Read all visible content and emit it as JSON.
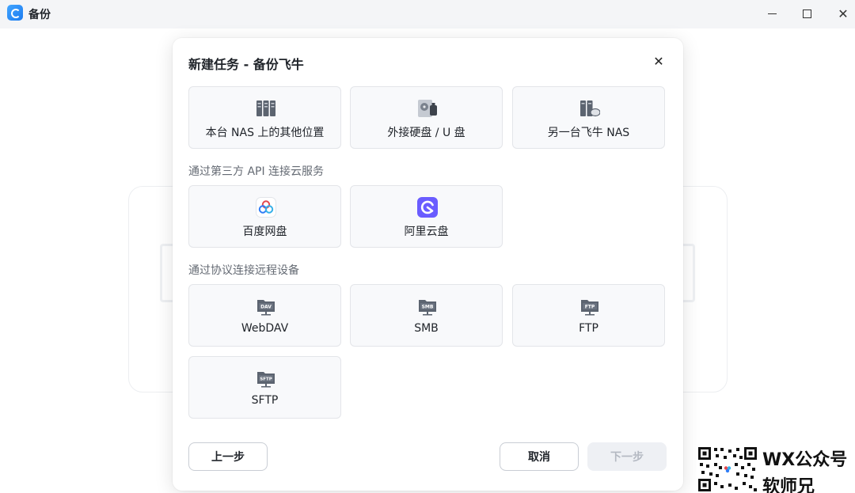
{
  "window": {
    "title": "备份",
    "controls": {
      "minimize": "minimize-icon",
      "maximize": "maximize-icon",
      "close": "✕"
    }
  },
  "dialog": {
    "title": "新建任务 - 备份飞牛",
    "close_glyph": "✕",
    "local_targets": [
      {
        "label": "本台 NAS 上的其他位置",
        "icon": "nas-server-icon"
      },
      {
        "label": "外接硬盘 / U 盘",
        "icon": "external-drive-icon"
      },
      {
        "label": "另一台飞牛 NAS",
        "icon": "remote-nas-icon"
      }
    ],
    "cloud_section_label": "通过第三方 API 连接云服务",
    "cloud_targets": [
      {
        "label": "百度网盘",
        "icon": "baidu-netdisk-icon"
      },
      {
        "label": "阿里云盘",
        "icon": "aliyun-drive-icon"
      }
    ],
    "protocol_section_label": "通过协议连接远程设备",
    "protocol_targets": [
      {
        "label": "WebDAV",
        "icon": "webdav-icon",
        "badge": "DAV"
      },
      {
        "label": "SMB",
        "icon": "smb-icon",
        "badge": "SMB"
      },
      {
        "label": "FTP",
        "icon": "ftp-icon",
        "badge": "FTP"
      },
      {
        "label": "SFTP",
        "icon": "sftp-icon",
        "badge": "SFTP"
      }
    ],
    "buttons": {
      "prev": "上一步",
      "cancel": "取消",
      "next": "下一步"
    }
  },
  "watermark": {
    "line1": "WX公众号",
    "line2": "软师兄"
  },
  "colors": {
    "accent": "#1b7bf0",
    "disabled_bg": "#eef0f4",
    "disabled_text": "#b4b9c2",
    "tile_bg": "#f8f9fb"
  }
}
